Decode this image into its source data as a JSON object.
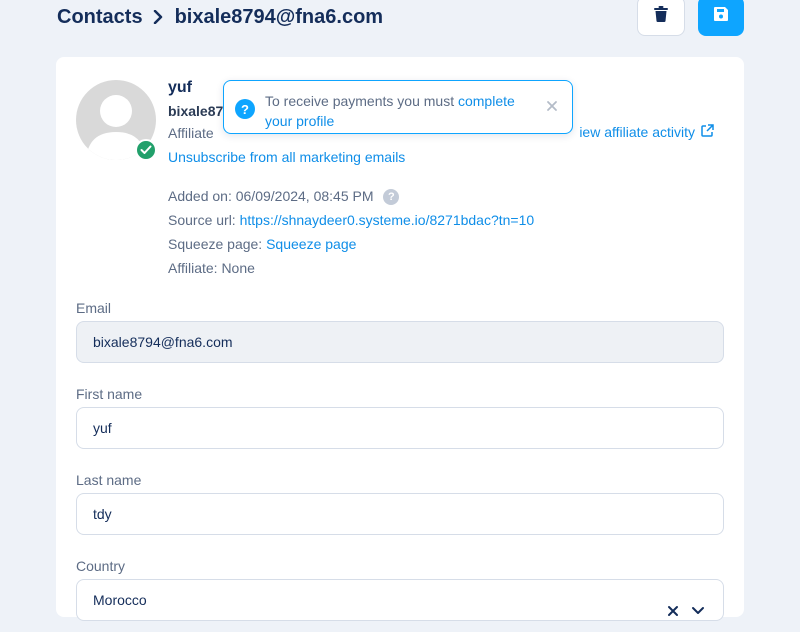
{
  "breadcrumb": {
    "root": "Contacts",
    "current": "bixale8794@fna6.com"
  },
  "toolbar": {
    "delete_icon": "trash-icon",
    "save_icon": "floppy-disk-icon"
  },
  "contact": {
    "name": "yuf",
    "email_short": "bixale87",
    "affiliate_label": "Affiliate",
    "view_activity": "iew affiliate activity",
    "unsubscribe": "Unsubscribe from all marketing emails",
    "added_on_label": "Added on:",
    "added_on_value": "06/09/2024, 08:45 PM",
    "source_url_label": "Source url:",
    "source_url_value": "https://shnaydeer0.systeme.io/8271bdac?tn=10",
    "squeeze_label": "Squeeze page:",
    "squeeze_value": "Squeeze page",
    "affiliate_info_label": "Affiliate:",
    "affiliate_info_value": "None"
  },
  "toast": {
    "text": "To receive payments you must",
    "link": "complete your profile"
  },
  "form": {
    "email_label": "Email",
    "email_value": "bixale8794@fna6.com",
    "first_name_label": "First name",
    "first_name_value": "yuf",
    "last_name_label": "Last name",
    "last_name_value": "tdy",
    "country_label": "Country",
    "country_value": "Morocco"
  },
  "colors": {
    "primary": "#0ea5ff",
    "link": "#0f8ee8",
    "heading": "#142d5a",
    "success": "#22a06b"
  }
}
